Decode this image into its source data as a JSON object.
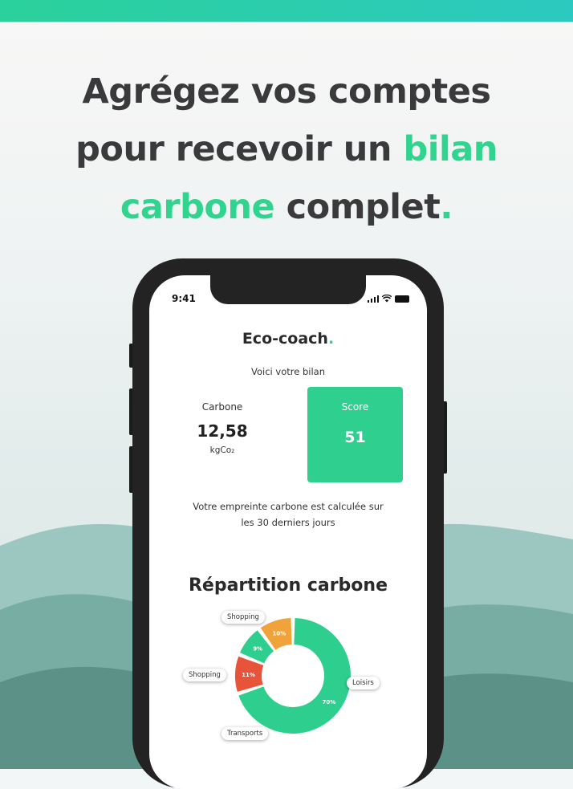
{
  "headline": {
    "line1": "Agrégez vos comptes",
    "line2_plain": "pour recevoir un ",
    "line2_accent": "bilan",
    "line3_accent": "carbone",
    "line3_plain": " complet",
    "line3_dot": "."
  },
  "colors": {
    "accent": "#2fd48f",
    "score_card": "#2fd08f",
    "segment_leisure": "#2ecf8e",
    "segment_transport": "#e8543a",
    "segment_shopping_small": "#2ecf8e",
    "segment_shopping_large": "#f0a33b"
  },
  "status_bar": {
    "time": "9:41",
    "icons": [
      "signal-icon",
      "wifi-icon",
      "battery-icon"
    ]
  },
  "app": {
    "title": "Eco-coach",
    "title_dot": ".",
    "subtitle": "Voici votre bilan",
    "carbon": {
      "label": "Carbone",
      "value": "12,58",
      "unit": "kgCo₂"
    },
    "score": {
      "label": "Score",
      "value": "51"
    },
    "note_line1": "Votre empreinte carbone est calculée sur",
    "note_line2": "les 30 derniers jours",
    "section_title": "Répartition carbone"
  },
  "chart_data": {
    "type": "pie",
    "segments": [
      {
        "label": "Loisirs",
        "percent_label": "70%",
        "value": 70,
        "color": "#2ecf8e"
      },
      {
        "label": "Transports",
        "percent_label": "11%",
        "value": 11,
        "color": "#e8543a"
      },
      {
        "label": "Shopping",
        "percent_label": "9%",
        "value": 9,
        "color": "#2ecf8e"
      },
      {
        "label": "Shopping",
        "percent_label": "10%",
        "value": 10,
        "color": "#f0a33b"
      }
    ]
  }
}
